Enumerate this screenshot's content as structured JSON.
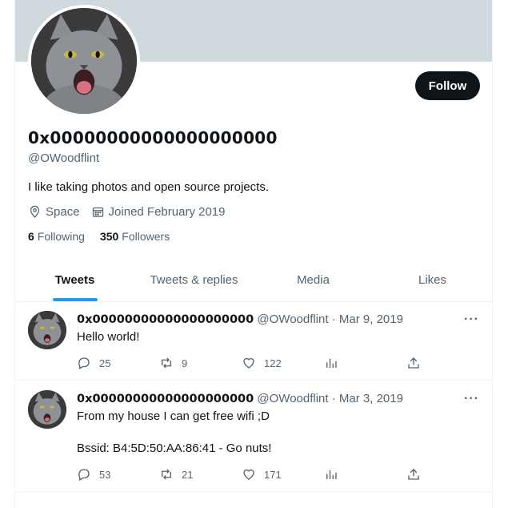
{
  "profile": {
    "display_name": "0x00000000000000000000",
    "handle": "@OWoodflint",
    "bio": "I like taking photos and open source projects.",
    "location": "Space",
    "joined": "Joined February 2019",
    "following_count": "6",
    "following_label": "Following",
    "followers_count": "350",
    "followers_label": "Followers",
    "follow_label": "Follow"
  },
  "tabs": [
    {
      "label": "Tweets",
      "active": true
    },
    {
      "label": "Tweets & replies",
      "active": false
    },
    {
      "label": "Media",
      "active": false
    },
    {
      "label": "Likes",
      "active": false
    }
  ],
  "tweets": [
    {
      "name": "0x00000000000000000000",
      "handle_date": "@OWoodflint · Mar 9, 2019",
      "text": "Hello world!",
      "replies": "25",
      "retweets": "9",
      "likes": "122"
    },
    {
      "name": "0x00000000000000000000",
      "handle_date": "@OWoodflint · Mar 3, 2019",
      "text": "From my house I can get free wifi ;D\n\nBssid: B4:5D:50:AA:86:41 - Go nuts!",
      "replies": "53",
      "retweets": "21",
      "likes": "171"
    }
  ],
  "more_label": "···",
  "colors": {
    "accent": "#1d9bf0",
    "text": "#0f1419",
    "muted": "#536471",
    "banner": "#cfd9de"
  }
}
